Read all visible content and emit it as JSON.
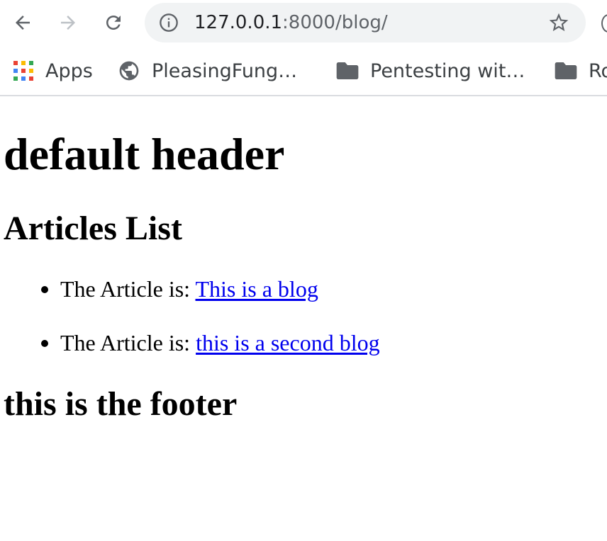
{
  "browser": {
    "address_bar": {
      "url_host": "127.0.0.1",
      "url_rest": ":8000/blog/"
    },
    "bookmarks": [
      {
        "label": "Apps",
        "icon": "apps-grid-icon"
      },
      {
        "label": "PleasingFung…",
        "icon": "globe-icon"
      },
      {
        "label": "Pentesting wit…",
        "icon": "folder-icon"
      },
      {
        "label": "Ro",
        "icon": "folder-icon"
      }
    ],
    "apps_colors": [
      "#ea4335",
      "#fbbc04",
      "#34a853",
      "#4285f4",
      "#ea4335",
      "#fbbc04",
      "#34a853",
      "#4285f4",
      "#ea4335"
    ]
  },
  "page": {
    "header": "default header",
    "articles_heading": "Articles List",
    "articles": [
      {
        "prefix": "The Article is: ",
        "link_text": "This is a blog"
      },
      {
        "prefix": "The Article is: ",
        "link_text": "this is a second blog"
      }
    ],
    "footer": "this is the footer"
  },
  "colors": {
    "link": "#0000ee",
    "omnibox_bg": "#f1f3f4",
    "icon_gray": "#5f6368"
  }
}
